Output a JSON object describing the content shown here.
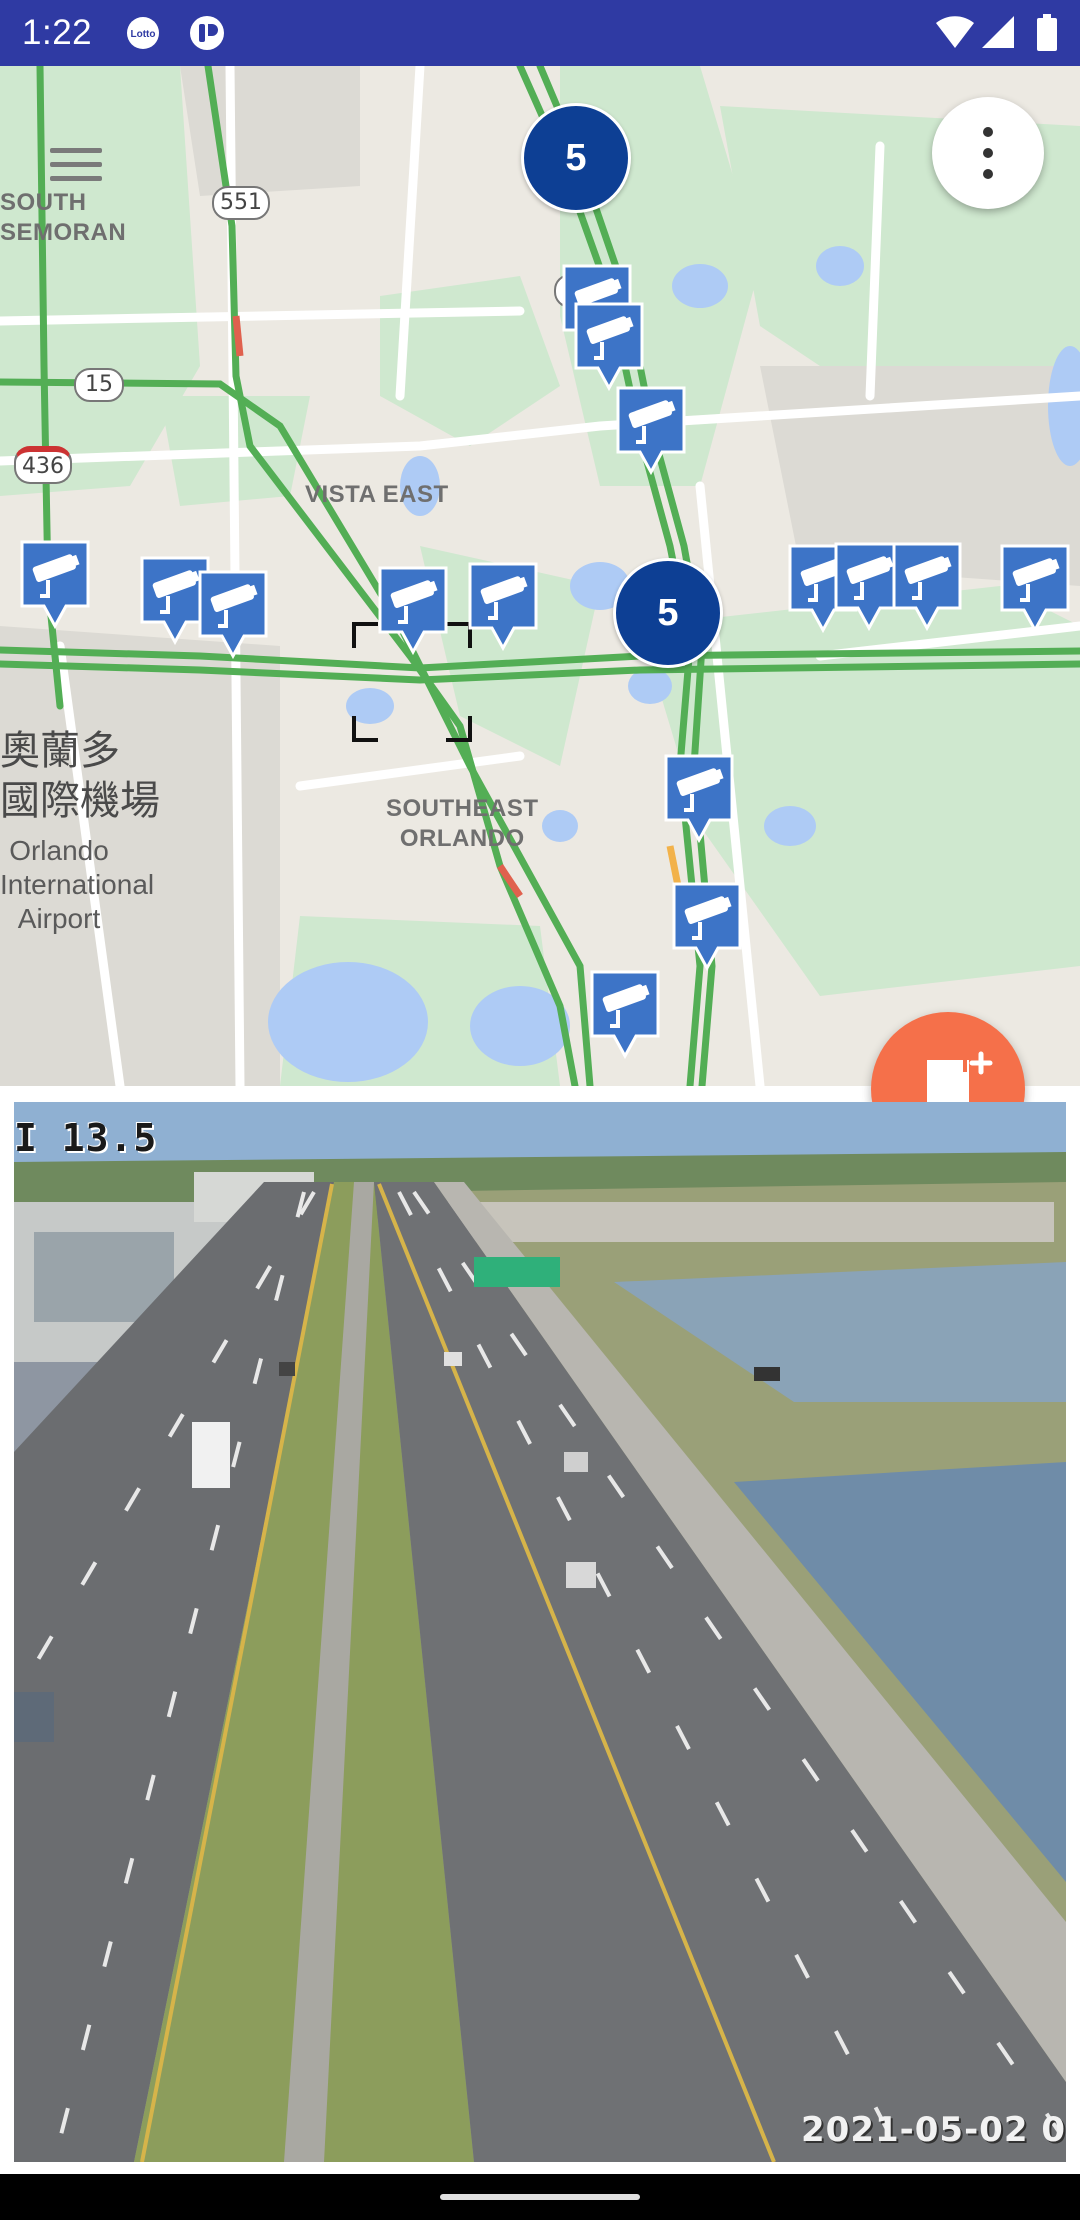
{
  "status_bar": {
    "time": "1:22",
    "notifications": [
      "lotto-app-icon",
      "messenger-icon"
    ],
    "system_icons": [
      "wifi-icon",
      "cellular-signal-icon",
      "battery-icon"
    ]
  },
  "map": {
    "labels": {
      "south_semoran": "SOUTH\nSEMORAN",
      "vista_east": "VISTA EAST",
      "southeast_orlando": "SOUTHEAST\nORLANDO",
      "airport_cjk": "奧蘭多\n國際機場",
      "airport_en": "Orlando\nInternational\nAirport"
    },
    "route_shields": [
      "551",
      "15",
      "436",
      "4"
    ],
    "clusters": [
      {
        "count": "5"
      },
      {
        "count": "5"
      }
    ],
    "camera_marker_icon": "traffic-camera-icon",
    "accent_marker_color": "#3d74c7",
    "cluster_color": "#0d3f94",
    "highway_color": "#4caf50"
  },
  "fab": {
    "icon": "add-bookmark-icon",
    "color": "#f5704a"
  },
  "camera_feed": {
    "overlay_top": "I 13.5",
    "overlay_bottom": "2021-05-02 0"
  }
}
